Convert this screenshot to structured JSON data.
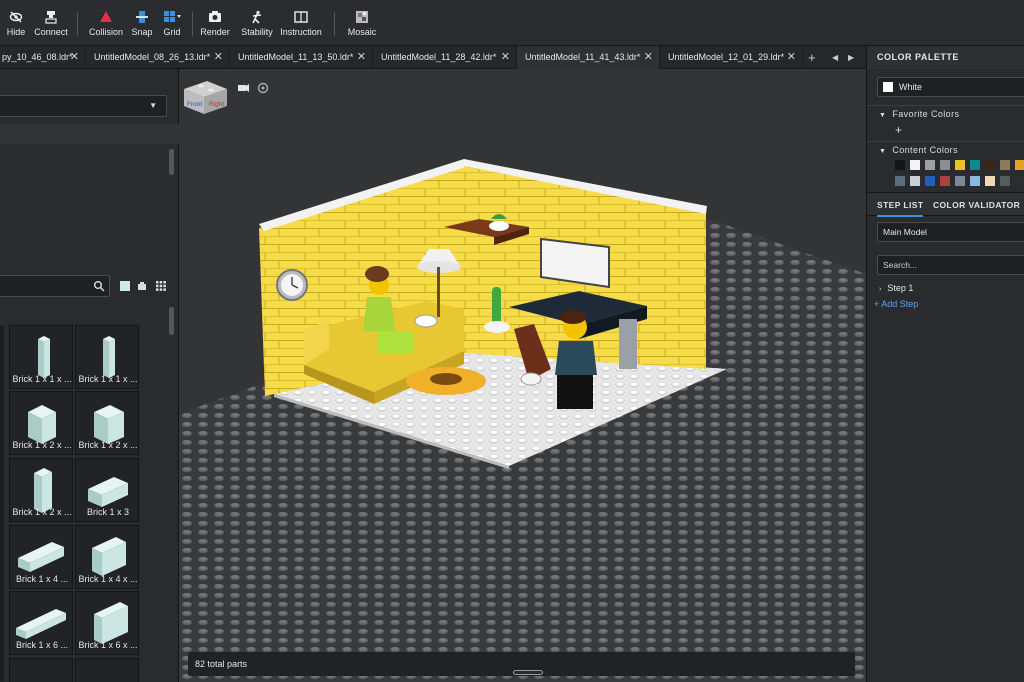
{
  "toolbar": {
    "buttons": [
      {
        "label": "Hide",
        "icon": "eye-slash-icon"
      },
      {
        "label": "Connect",
        "icon": "connect-icon"
      },
      {
        "label": "Collision",
        "icon": "collision-icon"
      },
      {
        "label": "Snap",
        "icon": "snap-icon"
      },
      {
        "label": "Grid",
        "icon": "grid-icon"
      },
      {
        "label": "Render",
        "icon": "camera-icon"
      },
      {
        "label": "Stability",
        "icon": "stability-icon"
      },
      {
        "label": "Instruction",
        "icon": "instruction-icon"
      },
      {
        "label": "Mosaic",
        "icon": "mosaic-icon"
      }
    ],
    "accent": "#e0324a"
  },
  "tabs": [
    {
      "label": "py_10_46_08.ldr*"
    },
    {
      "label": "UntitledModel_08_26_13.ldr*"
    },
    {
      "label": "UntitledModel_11_13_50.ldr*"
    },
    {
      "label": "UntitledModel_11_28_42.ldr*"
    },
    {
      "label": "UntitledModel_11_41_43.ldr*",
      "active": true
    },
    {
      "label": "UntitledModel_12_01_29.ldr*"
    }
  ],
  "tab_controls": {
    "add": "+",
    "prev": "◀",
    "next": "▶"
  },
  "parts": [
    {
      "label": "Brick 1 x 1 x ..."
    },
    {
      "label": "Brick 1 x 1 x ..."
    },
    {
      "label": "Brick 1 x 2 x ..."
    },
    {
      "label": "Brick 1 x 2 x ..."
    },
    {
      "label": "Brick 1 x 2 x ..."
    },
    {
      "label": "Brick 1 x 3"
    },
    {
      "label": "Brick 1 x 4 ..."
    },
    {
      "label": "Brick 1 x 4 x ..."
    },
    {
      "label": "Brick 1 x 6 ..."
    },
    {
      "label": "Brick 1 x 6 x ..."
    }
  ],
  "viewport": {
    "view_cube": {
      "front": "Front",
      "right": "Right"
    },
    "status": "82 total parts"
  },
  "color_palette": {
    "title": "COLOR PALETTE",
    "selected": "White",
    "favorite_title": "Favorite Colors",
    "favorite_add": "+",
    "content_title": "Content Colors",
    "content_colors": [
      "#10161c",
      "#f4f4f4",
      "#9ba0a3",
      "#8a8f92",
      "#e8c21f",
      "#0a8a8f",
      "#3a2618",
      "#8c7a5c",
      "#e8a21f",
      "#5a6e80",
      "#c9d0d6",
      "#1f5fbf",
      "#b04040",
      "#7d8a96",
      "#86b8e0",
      "#f0d8b0",
      "#555c60",
      "#2a2e32"
    ]
  },
  "step_panel": {
    "tabs": [
      "STEP LIST",
      "COLOR VALIDATOR"
    ],
    "model": "Main Model",
    "search_placeholder": "Search...",
    "step": "Step 1",
    "add_step": "+ Add Step"
  }
}
